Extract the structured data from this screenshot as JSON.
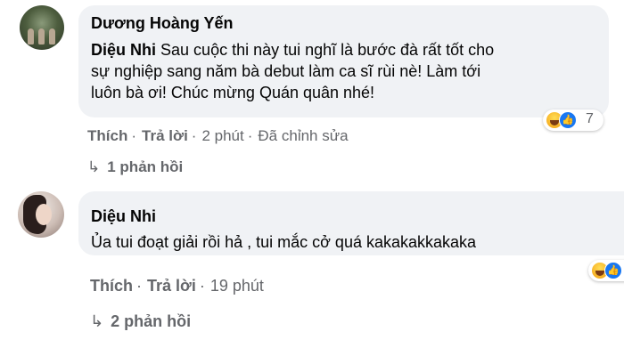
{
  "comment1": {
    "author": "Dương Hoàng Yến",
    "mention": "Diệu Nhi",
    "text_line1": "Sau cuộc thi này tui nghĩ là bước đà rất tốt cho",
    "text_line2": "sự nghiệp sang năm bà debut làm ca sĩ rùi nè! Làm tới",
    "text_line3": "luôn bà ơi! Chúc mừng Quán quân nhé!",
    "reaction_count": "7",
    "actions": {
      "like": "Thích",
      "reply": "Trả lời",
      "time": "2 phút",
      "edited": "Đã chỉnh sửa"
    },
    "replies": "1 phản hồi"
  },
  "comment2": {
    "author": "Diệu Nhi",
    "text": "Ủa tui đoạt giải rồi hả , tui mắc cở quá kakakakkakaka",
    "actions": {
      "like": "Thích",
      "reply": "Trả lời",
      "time": "19 phút"
    },
    "replies": "2 phản hồi"
  },
  "icons": {
    "reaction_haha": "haha-emoji-icon",
    "reaction_like": "like-icon",
    "reply_arrow": "reply-arrow-icon"
  },
  "colors": {
    "bubble": "#f0f2f5",
    "secondary_text": "#65676b",
    "like_blue": "#1877f2"
  }
}
